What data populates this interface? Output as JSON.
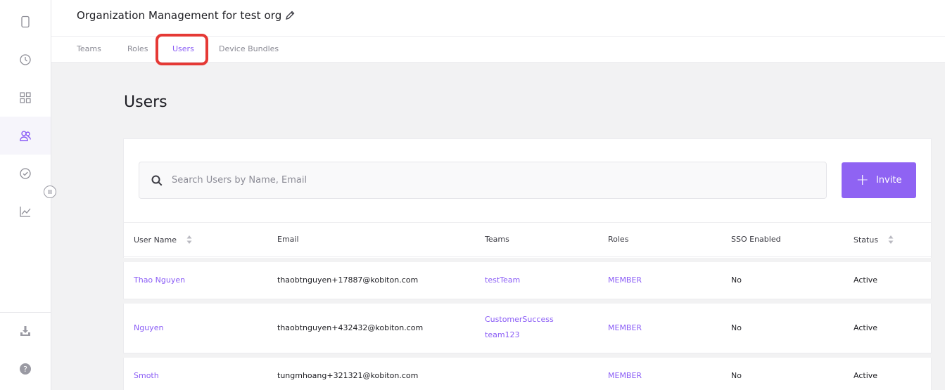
{
  "header": {
    "title": "Organization Management for test org"
  },
  "tabs": [
    {
      "label": "Teams"
    },
    {
      "label": "Roles"
    },
    {
      "label": "Users"
    },
    {
      "label": "Device Bundles"
    }
  ],
  "active_tab": "Users",
  "page": {
    "title": "Users"
  },
  "search": {
    "placeholder": "Search Users by Name, Email",
    "value": ""
  },
  "invite": {
    "label": "Invite"
  },
  "table": {
    "columns": [
      "User Name",
      "Email",
      "Teams",
      "Roles",
      "SSO Enabled",
      "Status"
    ],
    "rows": [
      {
        "name": "Thao Nguyen",
        "email": "thaobtnguyen+17887@kobiton.com",
        "teams": [
          "testTeam"
        ],
        "role": "MEMBER",
        "sso": "No",
        "status": "Active"
      },
      {
        "name": "Nguyen",
        "email": "thaobtnguyen+432432@kobiton.com",
        "teams": [
          "CustomerSuccess",
          "team123"
        ],
        "role": "MEMBER",
        "sso": "No",
        "status": "Active"
      },
      {
        "name": "Smoth",
        "email": "tungmhoang+321321@kobiton.com",
        "teams": [],
        "role": "MEMBER",
        "sso": "No",
        "status": "Active"
      }
    ]
  },
  "sidebar": {
    "items": [
      {
        "icon": "device-icon"
      },
      {
        "icon": "clock-icon"
      },
      {
        "icon": "grid-icon"
      },
      {
        "icon": "users-icon"
      },
      {
        "icon": "check-circle-icon"
      },
      {
        "icon": "chart-icon"
      }
    ],
    "bottom": [
      {
        "icon": "download-icon"
      },
      {
        "icon": "help-icon"
      }
    ]
  },
  "colors": {
    "accent": "#8a5cf6",
    "button": "#8f63f3",
    "highlight": "#e53935"
  }
}
